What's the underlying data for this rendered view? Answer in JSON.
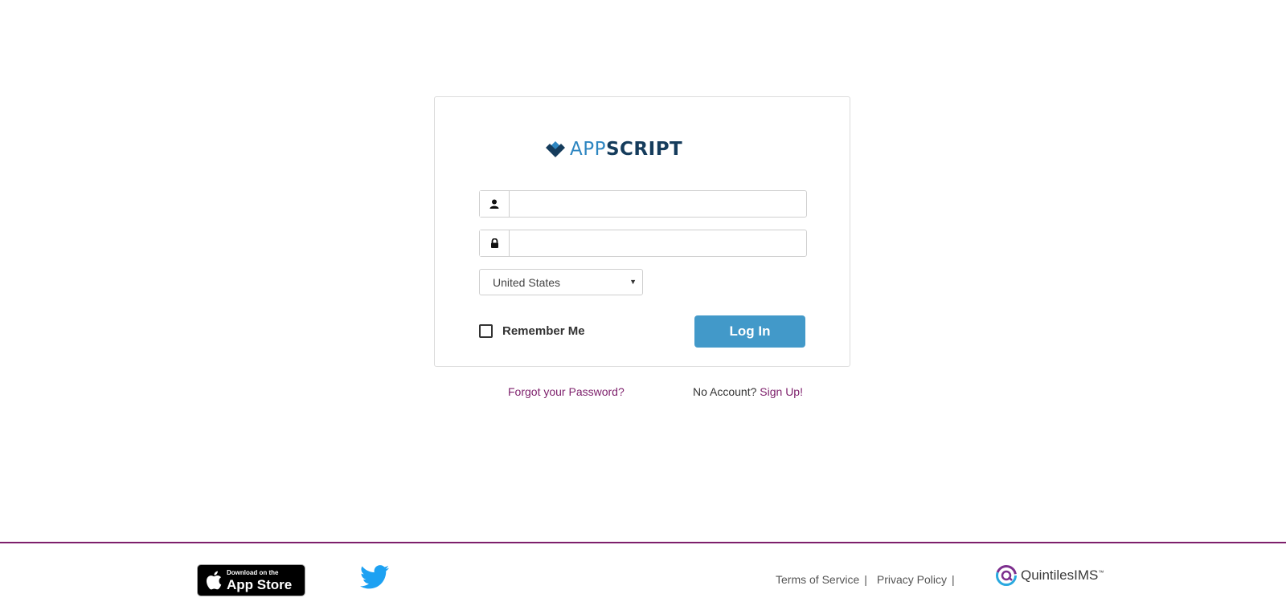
{
  "brand": {
    "logo_app": "APP",
    "logo_script": "SCRIPT",
    "colors": {
      "app": "#2e86c1",
      "script": "#153c5c"
    }
  },
  "login_form": {
    "username_icon": "user-icon",
    "username_value": "",
    "password_icon": "lock-icon",
    "password_value": "",
    "country_selected": "United States",
    "remember_label": "Remember Me",
    "remember_checked": false,
    "login_button_label": "Log In",
    "login_button_color": "#4299c9"
  },
  "links": {
    "forgot_password": "Forgot your Password?",
    "no_account_text": "No Account?",
    "sign_up": "Sign Up!",
    "link_color": "#7d1f6b"
  },
  "footer": {
    "divider_color": "#7d1f6b",
    "appstore_small": "Download on the",
    "appstore_big": "App Store",
    "twitter_icon": "twitter-icon",
    "terms": "Terms of Service",
    "privacy": "Privacy Policy",
    "separator": "|",
    "partner_logo_text": "QuintilesIMS",
    "partner_tm": "™"
  }
}
